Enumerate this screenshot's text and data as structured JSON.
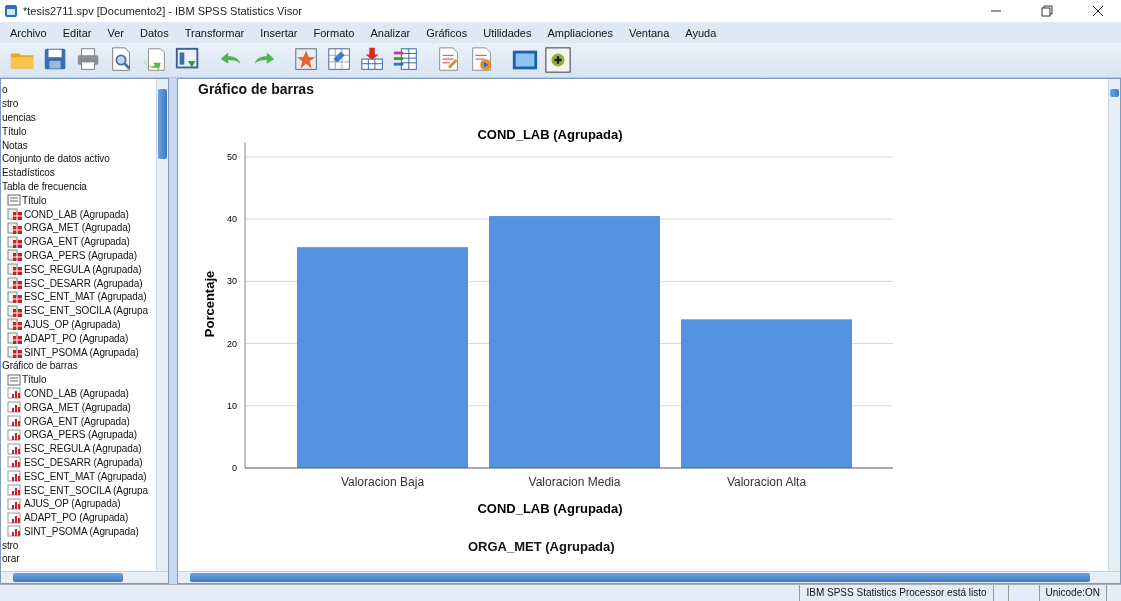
{
  "window": {
    "title": "*tesis2711.spv [Documento2] - IBM SPSS Statistics Visor"
  },
  "menu": [
    "Archivo",
    "Editar",
    "Ver",
    "Datos",
    "Transformar",
    "Insertar",
    "Formato",
    "Analizar",
    "Gráficos",
    "Utilidades",
    "Ampliaciones",
    "Ventana",
    "Ayuda"
  ],
  "toolbar": [
    {
      "kind": "folder"
    },
    {
      "kind": "save"
    },
    {
      "kind": "print"
    },
    {
      "kind": "preview"
    },
    {
      "kind": "export"
    },
    {
      "kind": "dialog"
    },
    {
      "kind": "undo"
    },
    {
      "kind": "redo"
    },
    {
      "kind": "star"
    },
    {
      "kind": "grid"
    },
    {
      "kind": "insert"
    },
    {
      "kind": "list"
    },
    {
      "kind": "doc"
    },
    {
      "kind": "docplay"
    },
    {
      "kind": "screen"
    },
    {
      "kind": "plus"
    }
  ],
  "outline": [
    {
      "label": "o"
    },
    {
      "label": "stro"
    },
    {
      "label": "uencias"
    },
    {
      "label": "Título"
    },
    {
      "label": "Notas"
    },
    {
      "label": "Conjunto de datos activo"
    },
    {
      "label": "Estadísticos"
    },
    {
      "label": "Tabla de frecuencia",
      "children": [
        {
          "label": "Título",
          "kind": "title"
        },
        {
          "label": "COND_LAB (Agrupada)",
          "kind": "table"
        },
        {
          "label": "ORGA_MET (Agrupada)",
          "kind": "table"
        },
        {
          "label": "ORGA_ENT (Agrupada)",
          "kind": "table"
        },
        {
          "label": "ORGA_PERS (Agrupada)",
          "kind": "table"
        },
        {
          "label": "ESC_REGULA (Agrupada)",
          "kind": "table"
        },
        {
          "label": "ESC_DESARR (Agrupada)",
          "kind": "table"
        },
        {
          "label": "ESC_ENT_MAT (Agrupada)",
          "kind": "table"
        },
        {
          "label": "ESC_ENT_SOCILA (Agrupa",
          "kind": "table"
        },
        {
          "label": "AJUS_OP (Agrupada)",
          "kind": "table"
        },
        {
          "label": "ADAPT_PO (Agrupada)",
          "kind": "table"
        },
        {
          "label": "SINT_PSOMA (Agrupada)",
          "kind": "table"
        }
      ]
    },
    {
      "label": "Gráfico de barras",
      "children": [
        {
          "label": "Título",
          "kind": "title"
        },
        {
          "label": "COND_LAB (Agrupada)",
          "kind": "chart"
        },
        {
          "label": "ORGA_MET (Agrupada)",
          "kind": "chart"
        },
        {
          "label": "ORGA_ENT (Agrupada)",
          "kind": "chart"
        },
        {
          "label": "ORGA_PERS (Agrupada)",
          "kind": "chart"
        },
        {
          "label": "ESC_REGULA (Agrupada)",
          "kind": "chart"
        },
        {
          "label": "ESC_DESARR (Agrupada)",
          "kind": "chart"
        },
        {
          "label": "ESC_ENT_MAT (Agrupada)",
          "kind": "chart"
        },
        {
          "label": "ESC_ENT_SOCILA (Agrupa",
          "kind": "chart"
        },
        {
          "label": "AJUS_OP (Agrupada)",
          "kind": "chart"
        },
        {
          "label": "ADAPT_PO (Agrupada)",
          "kind": "chart"
        },
        {
          "label": "SINT_PSOMA (Agrupada)",
          "kind": "chart"
        }
      ]
    },
    {
      "label": "stro"
    },
    {
      "label": "orar"
    }
  ],
  "viewer": {
    "heading": "Gráfico de barras",
    "chart_data": {
      "type": "bar",
      "title": "COND_LAB (Agrupada)",
      "xlabel": "COND_LAB (Agrupada)",
      "ylabel": "Porcentaje",
      "categories": [
        "Valoracion Baja",
        "Valoracion Media",
        "Valoracion Alta"
      ],
      "values": [
        35.5,
        40.5,
        23.9
      ],
      "ylim": [
        0,
        52.4
      ],
      "yticks": [
        0,
        10,
        20,
        30,
        40,
        50
      ],
      "grid": true
    },
    "next_title": "ORGA_MET (Agrupada)"
  },
  "status_bar": {
    "message": "IBM SPSS Statistics Processor está listo",
    "encoding": "Unicode:ON"
  }
}
